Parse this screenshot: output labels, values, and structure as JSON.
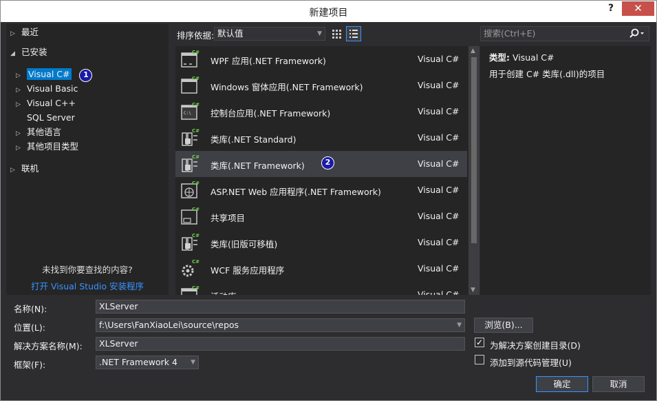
{
  "dialog": {
    "title": "新建项目",
    "help": "?",
    "close": "✕"
  },
  "tree": {
    "recent": "最近",
    "installed": "已安装",
    "items": [
      {
        "label": "Visual C#",
        "badge": "1"
      },
      {
        "label": "Visual Basic"
      },
      {
        "label": "Visual C++"
      },
      {
        "label": "SQL Server"
      },
      {
        "label": "其他语言"
      },
      {
        "label": "其他项目类型"
      }
    ],
    "online": "联机",
    "not_found": "未找到你要查找的内容?",
    "open_installer": "打开 Visual Studio 安装程序"
  },
  "sortbar": {
    "label": "排序依据:",
    "value": "默认值"
  },
  "search": {
    "placeholder": "搜索(Ctrl+E)"
  },
  "templates": [
    {
      "name": "WPF 应用(.NET Framework)",
      "lang": "Visual C#",
      "icon": "wpf-app-icon"
    },
    {
      "name": "Windows 窗体应用(.NET Framework)",
      "lang": "Visual C#",
      "icon": "winforms-app-icon"
    },
    {
      "name": "控制台应用(.NET Framework)",
      "lang": "Visual C#",
      "icon": "console-app-icon"
    },
    {
      "name": "类库(.NET Standard)",
      "lang": "Visual C#",
      "icon": "class-library-icon"
    },
    {
      "name": "类库(.NET Framework)",
      "lang": "Visual C#",
      "icon": "class-library-icon",
      "badge": "2"
    },
    {
      "name": "ASP.NET Web 应用程序(.NET Framework)",
      "lang": "Visual C#",
      "icon": "web-app-icon"
    },
    {
      "name": "共享项目",
      "lang": "Visual C#",
      "icon": "shared-project-icon"
    },
    {
      "name": "类库(旧版可移植)",
      "lang": "Visual C#",
      "icon": "class-library-icon"
    },
    {
      "name": "WCF 服务应用程序",
      "lang": "Visual C#",
      "icon": "wcf-service-icon"
    },
    {
      "name": "活动库",
      "lang": "Visual C#",
      "icon": "activity-library-icon"
    }
  ],
  "details": {
    "type_label": "类型:",
    "type_value": "Visual C#",
    "description": "用于创建 C# 类库(.dll)的项目"
  },
  "form": {
    "name_label": "名称(N):",
    "name_value": "XLServer",
    "location_label": "位置(L):",
    "location_value": "f:\\Users\\FanXiaoLei\\source\\repos",
    "solution_label": "解决方案名称(M):",
    "solution_value": "XLServer",
    "framework_label": "框架(F):",
    "framework_value": ".NET Framework 4",
    "browse": "浏览(B)...",
    "create_dir": "为解决方案创建目录(D)",
    "create_dir_checked": true,
    "add_source_control": "添加到源代码管理(U)",
    "add_source_control_checked": false,
    "ok": "确定",
    "cancel": "取消"
  },
  "colors": {
    "accent": "#3399ff",
    "selected_item": "#007acc",
    "link": "#3794ff",
    "close": "#c7504a",
    "badge": "#1a1aa6"
  }
}
